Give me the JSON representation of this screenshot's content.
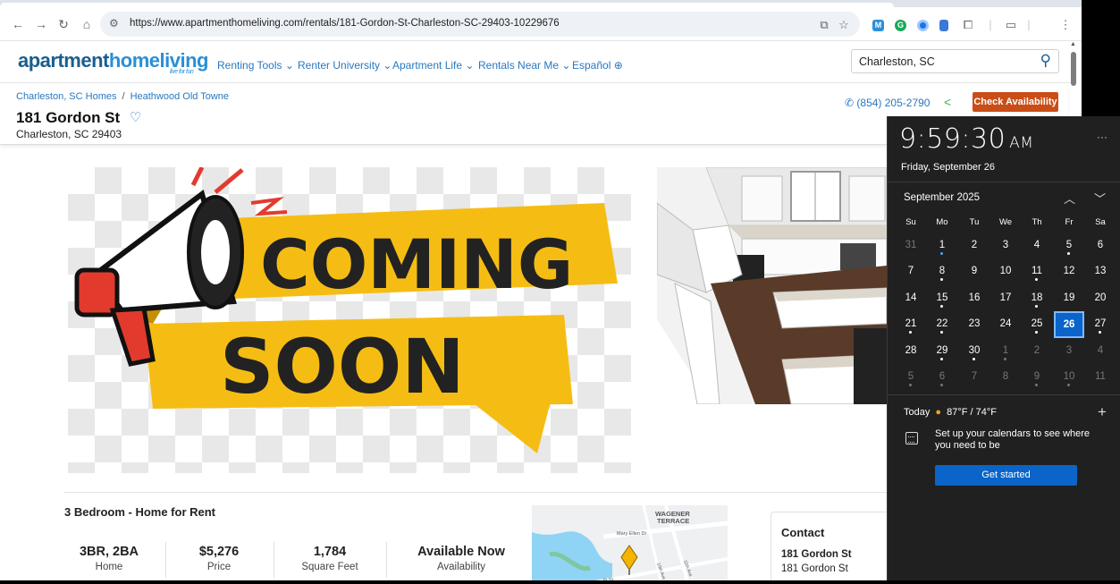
{
  "browser": {
    "url": "https://www.apartmenthomeliving.com/rentals/181-Gordon-St-Charleston-SC-29403-10229676"
  },
  "site": {
    "logo_part1": "apartment",
    "logo_part2": "homeliving",
    "logo_tagline": "live for fun",
    "nav": [
      "Renting Tools",
      "Renter University",
      "Apartment Life",
      "Rentals Near Me",
      "Español"
    ],
    "search_value": "Charleston, SC"
  },
  "listing": {
    "breadcrumb": [
      "Charleston, SC Homes",
      "Heathwood Old Towne"
    ],
    "title": "181 Gordon St",
    "address": "Charleston, SC 29403",
    "phone": "(854) 205-2790",
    "cta": "Check Availability",
    "hero_line1": "COMING",
    "hero_line2": "SOON",
    "section_title": "3 Bedroom - Home for Rent",
    "stats": [
      {
        "value": "3BR, 2BA",
        "label": "Home"
      },
      {
        "value": "$5,276",
        "label": "Price"
      },
      {
        "value": "1,784",
        "label": "Square Feet"
      },
      {
        "value": "Available Now",
        "label": "Availability"
      }
    ],
    "map_labels": [
      "WAGENER",
      "TERRACE",
      "Mary Ellen Dr",
      "10th Ave",
      "11th Ave",
      "in St"
    ],
    "contact": {
      "heading": "Contact",
      "name": "181 Gordon St",
      "address": "181 Gordon St"
    }
  },
  "flyout": {
    "time": "9:59:30",
    "ampm": "AM",
    "date_long": "Friday, September 26",
    "month": "September 2025",
    "weekdays": [
      "Su",
      "Mo",
      "Tu",
      "We",
      "Th",
      "Fr",
      "Sa"
    ],
    "weeks": [
      [
        {
          "d": "31",
          "dim": true
        },
        {
          "d": "1",
          "dot": "blue"
        },
        {
          "d": "2"
        },
        {
          "d": "3"
        },
        {
          "d": "4"
        },
        {
          "d": "5",
          "dot": "w"
        },
        {
          "d": "6"
        }
      ],
      [
        {
          "d": "7"
        },
        {
          "d": "8",
          "dot": "w"
        },
        {
          "d": "9"
        },
        {
          "d": "10"
        },
        {
          "d": "11",
          "dot": "w"
        },
        {
          "d": "12"
        },
        {
          "d": "13"
        }
      ],
      [
        {
          "d": "14"
        },
        {
          "d": "15",
          "dot": "w"
        },
        {
          "d": "16"
        },
        {
          "d": "17"
        },
        {
          "d": "18",
          "dot": "w"
        },
        {
          "d": "19"
        },
        {
          "d": "20"
        }
      ],
      [
        {
          "d": "21",
          "dot": "w"
        },
        {
          "d": "22",
          "dot": "w"
        },
        {
          "d": "23"
        },
        {
          "d": "24"
        },
        {
          "d": "25",
          "dot": "w"
        },
        {
          "d": "26",
          "today": true
        },
        {
          "d": "27",
          "dot": "w"
        }
      ],
      [
        {
          "d": "28"
        },
        {
          "d": "29",
          "dot": "w"
        },
        {
          "d": "30",
          "dot": "w"
        },
        {
          "d": "1",
          "dim": true,
          "dot": "w"
        },
        {
          "d": "2",
          "dim": true
        },
        {
          "d": "3",
          "dim": true
        },
        {
          "d": "4",
          "dim": true
        }
      ],
      [
        {
          "d": "5",
          "dim": true,
          "dot": "w"
        },
        {
          "d": "6",
          "dim": true,
          "dot": "w"
        },
        {
          "d": "7",
          "dim": true
        },
        {
          "d": "8",
          "dim": true
        },
        {
          "d": "9",
          "dim": true,
          "dot": "w"
        },
        {
          "d": "10",
          "dim": true,
          "dot": "w"
        },
        {
          "d": "11",
          "dim": true
        }
      ]
    ],
    "today_label": "Today",
    "weather": "87°F / 74°F",
    "setup_text": "Set up your calendars to see where you need to be",
    "button": "Get started"
  },
  "colors": {
    "brand_blue": "#2878c0",
    "cta_orange": "#c94d16",
    "flyout_bg": "#202020",
    "accent_blue": "#0a64c9",
    "banner_yellow": "#f5bd14"
  }
}
